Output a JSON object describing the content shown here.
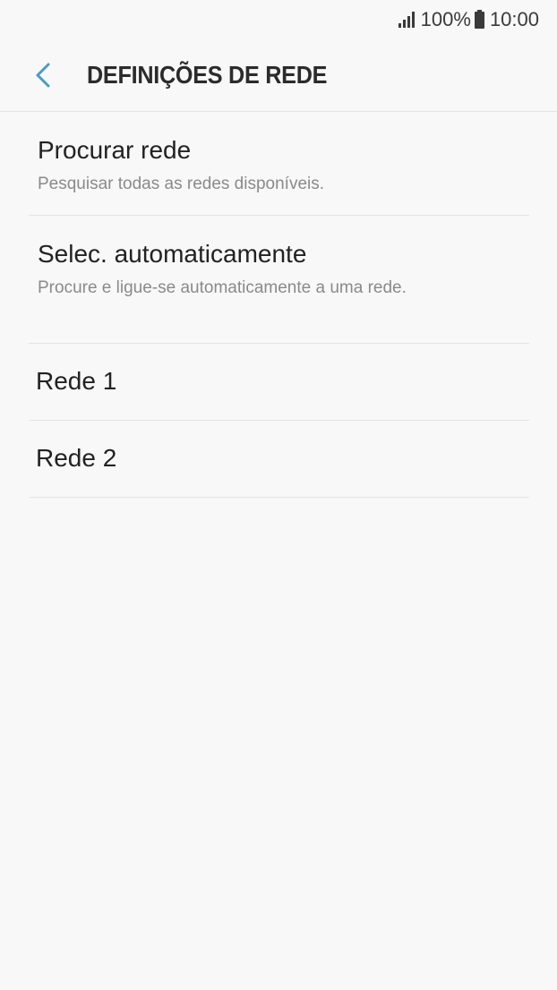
{
  "status_bar": {
    "battery": "100%",
    "time": "10:00",
    "icons": [
      "signal-icon",
      "battery-icon"
    ]
  },
  "header": {
    "title": "DEFINIÇÕES DE REDE",
    "back_icon": "chevron-left-icon",
    "accent_color": "#4a9cc0"
  },
  "list": {
    "items": [
      {
        "title": "Procurar rede",
        "subtitle": "Pesquisar todas as redes disponíveis."
      },
      {
        "title": "Selec. automaticamente",
        "subtitle": "Procure e ligue-se automaticamente a uma rede."
      },
      {
        "title": "Rede 1"
      },
      {
        "title": "Rede 2"
      }
    ]
  }
}
